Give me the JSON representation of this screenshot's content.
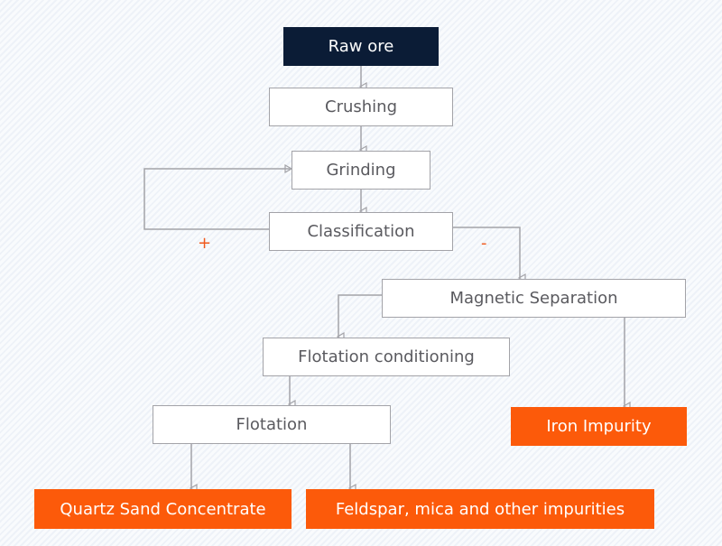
{
  "colors": {
    "start_fill": "#0b1c36",
    "output_fill": "#fc5a0a",
    "process_fill": "#ffffff",
    "process_border": "#a3a3a8",
    "connector": "#a3a3a8",
    "sign": "#f05a1e",
    "process_text": "#5a5a5f"
  },
  "nodes": {
    "raw_ore": "Raw ore",
    "crushing": "Crushing",
    "grinding": "Grinding",
    "classification": "Classification",
    "magnetic_separation": "Magnetic Separation",
    "flotation_conditioning": "Flotation conditioning",
    "flotation": "Flotation",
    "iron_impurity": "Iron Impurity",
    "quartz_sand_concentrate": "Quartz Sand Concentrate",
    "feldspar_mica_impurities": "Feldspar, mica and other impurities"
  },
  "labels": {
    "oversize": "+",
    "undersize": "-"
  },
  "edges": [
    {
      "from": "raw_ore",
      "to": "crushing"
    },
    {
      "from": "crushing",
      "to": "grinding"
    },
    {
      "from": "grinding",
      "to": "classification"
    },
    {
      "from": "classification",
      "to": "grinding",
      "label": "+"
    },
    {
      "from": "classification",
      "to": "magnetic_separation",
      "label": "-"
    },
    {
      "from": "magnetic_separation",
      "to": "flotation_conditioning"
    },
    {
      "from": "magnetic_separation",
      "to": "iron_impurity"
    },
    {
      "from": "flotation_conditioning",
      "to": "flotation"
    },
    {
      "from": "flotation",
      "to": "quartz_sand_concentrate"
    },
    {
      "from": "flotation",
      "to": "feldspar_mica_impurities"
    }
  ]
}
